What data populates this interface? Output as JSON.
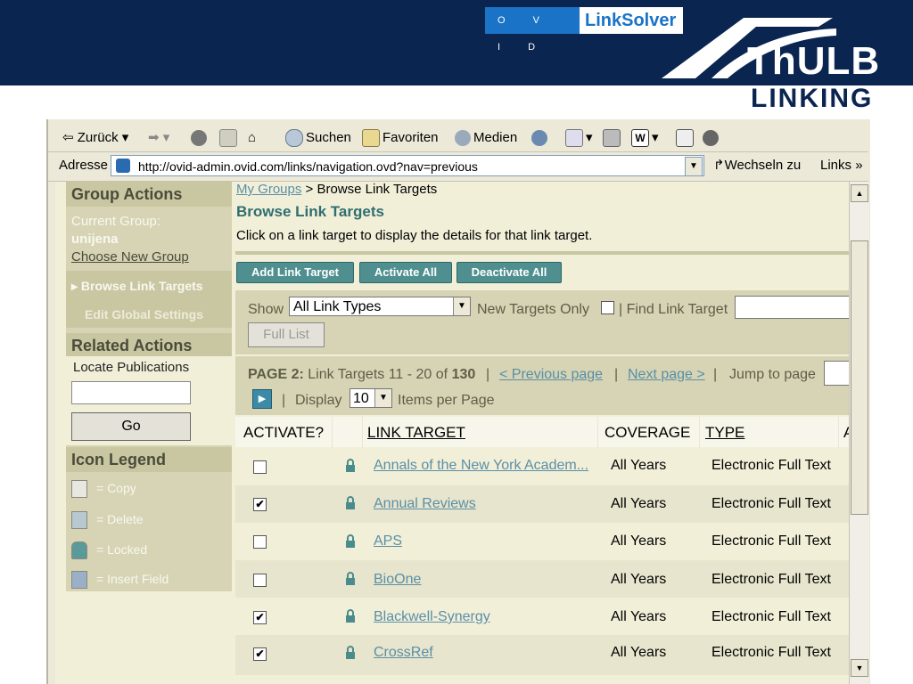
{
  "banner": {
    "ovid_label": "O V I D",
    "linksolver_label": "LinkSolver",
    "thulb_label": "ThULB",
    "linking_label": "LINKING"
  },
  "toolbar": {
    "back_label": "Zurück",
    "search_label": "Suchen",
    "favorites_label": "Favoriten",
    "media_label": "Medien"
  },
  "addressbar": {
    "label": "Adresse",
    "url": "http://ovid-admin.ovid.com/links/navigation.ovd?nav=previous",
    "go_label": "Wechseln zu",
    "links_label": "Links"
  },
  "sidebar": {
    "group_actions_heading": "Group Actions",
    "current_group_label": "Current Group:",
    "current_group_value": "unijena",
    "choose_new_group": "Choose New Group",
    "browse_link_targets": "Browse Link Targets",
    "edit_global_settings": "Edit Global Settings",
    "related_actions_heading": "Related Actions",
    "locate_publications": "Locate Publications",
    "go_button": "Go",
    "icon_legend_heading": "Icon Legend",
    "legend": [
      {
        "icon": "copy-icon",
        "label": "= Copy"
      },
      {
        "icon": "trash-icon",
        "label": "= Delete"
      },
      {
        "icon": "lock-icon",
        "label": "= Locked"
      },
      {
        "icon": "insert-field-icon",
        "label": "= Insert Field"
      }
    ]
  },
  "main": {
    "breadcrumb_link": "My Groups",
    "breadcrumb_rest": "> Browse Link Targets",
    "title": "Browse Link Targets",
    "instructions": "Click on a link target to display the details for that link target.",
    "buttons": {
      "add": "Add Link Target",
      "activate_all": "Activate All",
      "deactivate_all": "Deactivate All"
    },
    "filter": {
      "show_label": "Show",
      "show_value": "All Link Types",
      "new_targets_only": "New Targets Only",
      "find_label": "| Find Link Target",
      "full_list": "Full List"
    },
    "paging": {
      "page_label": "PAGE 2:",
      "range_text": "Link Targets 11 - 20 of",
      "total": "130",
      "sep1": "|",
      "previous": "< Previous page",
      "sep2": "|",
      "next": "Next page >",
      "sep3": "|",
      "jump_label": "Jump to page",
      "sep4": "|",
      "display_label": "Display",
      "display_value": "10",
      "items_per_page": "Items per Page"
    },
    "table": {
      "headers": {
        "activate": "ACTIVATE?",
        "link_target": "LINK TARGET",
        "coverage": "COVERAGE",
        "type": "TYPE",
        "extra": "A"
      },
      "rows": [
        {
          "checked": "",
          "name": "Annals of the New York Academ...",
          "coverage": "All Years",
          "type": "Electronic Full Text"
        },
        {
          "checked": "✔",
          "name": "Annual Reviews",
          "coverage": "All Years",
          "type": "Electronic Full Text"
        },
        {
          "checked": "",
          "name": "APS",
          "coverage": "All Years",
          "type": "Electronic Full Text"
        },
        {
          "checked": "",
          "name": "BioOne",
          "coverage": "All Years",
          "type": "Electronic Full Text"
        },
        {
          "checked": "✔",
          "name": "Blackwell-Synergy",
          "coverage": "All Years",
          "type": "Electronic Full Text"
        },
        {
          "checked": "✔",
          "name": "CrossRef",
          "coverage": "All Years",
          "type": "Electronic Full Text"
        }
      ]
    }
  },
  "colors": {
    "banner": "#0a2550",
    "ovid_blue": "#1a73c6",
    "sidebar": "#d6d4b4",
    "teal_button": "#4f8f8f",
    "link": "#5a8fa6",
    "title_teal": "#2f6f6f"
  }
}
